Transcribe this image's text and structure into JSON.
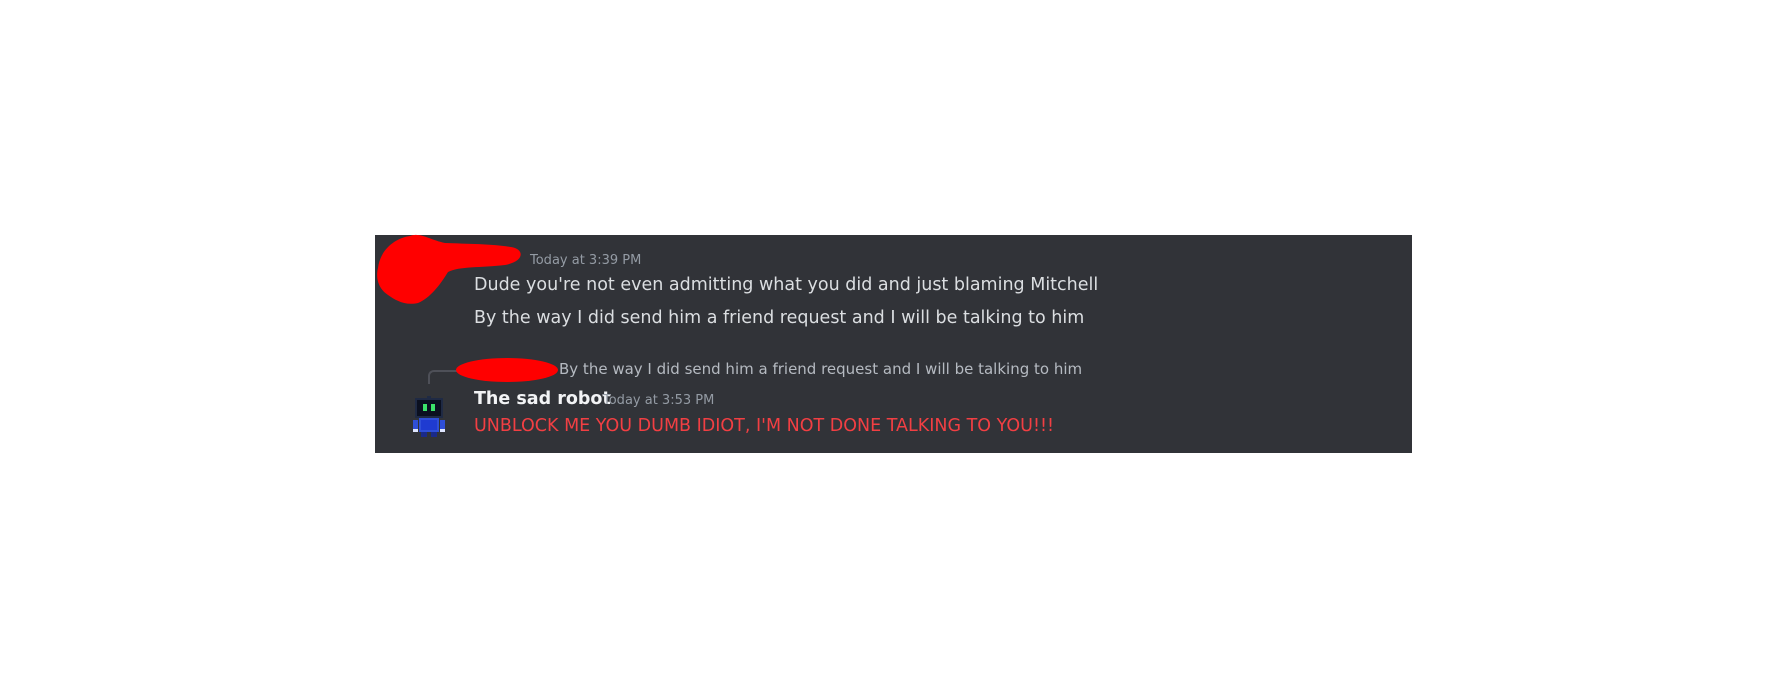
{
  "message_group_1": {
    "timestamp": "Today at 3:39 PM",
    "lines": [
      "Dude you're not even admitting what you did and just blaming Mitchell",
      "By the way I did send him a friend request and I will be talking to him"
    ]
  },
  "message_group_2": {
    "reply_preview": "By the way I did send him a friend request and I will be talking to him",
    "username": "The sad robot",
    "timestamp": "Today at 3:53 PM",
    "text": "UNBLOCK ME YOU DUMB IDIOT, I'M NOT DONE TALKING TO YOU!!!",
    "text_color": "#f23f43",
    "avatar_icon": "robot-icon"
  },
  "colors": {
    "panel_background": "#313338",
    "redaction": "#ff0000"
  }
}
